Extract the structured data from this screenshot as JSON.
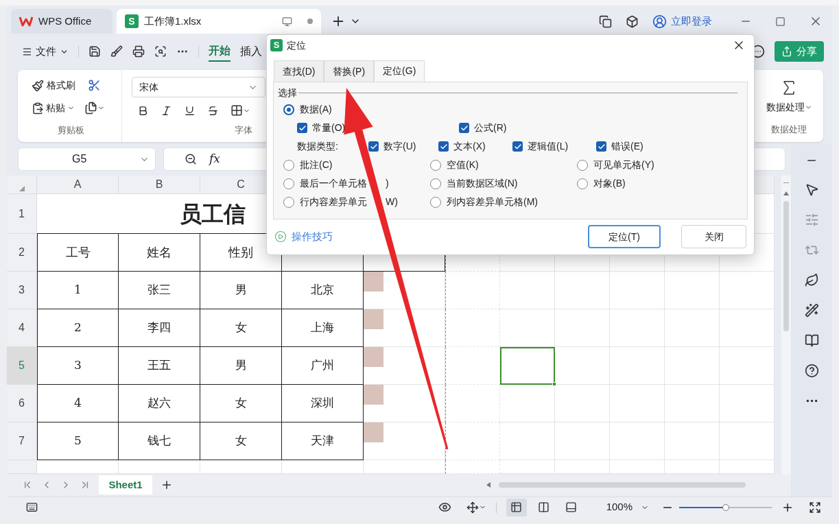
{
  "window_tabs": [
    {
      "label": "WPS Office",
      "kind": "home",
      "selected": false
    },
    {
      "label": "工作簿1.xlsx",
      "kind": "sheet",
      "icon_letter": "S",
      "selected": true
    }
  ],
  "login": "立即登录",
  "menu": {
    "file": "文件",
    "tabs": [
      {
        "label": "开始",
        "selected": true
      },
      {
        "label": "插入",
        "selected": false
      }
    ],
    "share": "分享"
  },
  "ribbon": {
    "format_painter": "格式刷",
    "paste": "粘贴",
    "clipboard_title": "剪贴板",
    "font_name": "宋体",
    "font_title": "字体",
    "data_button": "数据处理",
    "data_title": "数据处理"
  },
  "formula_bar": {
    "name_box": "G5",
    "function": "fx"
  },
  "sheet": {
    "columns": [
      "A",
      "B",
      "C"
    ],
    "rows": [
      {
        "label": "1",
        "selected": false
      },
      {
        "label": "2",
        "selected": false
      },
      {
        "label": "3",
        "selected": false
      },
      {
        "label": "4",
        "selected": false
      },
      {
        "label": "5",
        "selected": true
      },
      {
        "label": "6",
        "selected": false
      },
      {
        "label": "7",
        "selected": false
      }
    ],
    "title": "员工信",
    "header": [
      "工号",
      "姓名",
      "性别"
    ],
    "records": [
      [
        "1",
        "张三",
        "男",
        "北京"
      ],
      [
        "2",
        "李四",
        "女",
        "上海"
      ],
      [
        "3",
        "王五",
        "男",
        "广州"
      ],
      [
        "4",
        "赵六",
        "女",
        "深圳"
      ],
      [
        "5",
        "钱七",
        "女",
        "天津"
      ]
    ]
  },
  "sheet_tabs": [
    {
      "label": "Sheet1",
      "selected": true
    }
  ],
  "status_bar": {
    "views": [
      {
        "kind": "normal",
        "selected": true
      },
      {
        "kind": "columns",
        "selected": false
      },
      {
        "kind": "reading",
        "selected": false
      }
    ],
    "zoom": "100%",
    "zoom_slider": {
      "level": 0.5
    }
  },
  "dialog": {
    "icon_letter": "S",
    "title": "定位",
    "tabs": [
      {
        "label": "查找(D)",
        "selected": false
      },
      {
        "label": "替换(P)",
        "selected": false
      },
      {
        "label": "定位(G)",
        "selected": true
      }
    ],
    "group": "选择",
    "data_option": {
      "label": "数据(A)",
      "selected": true
    },
    "data_checks": [
      {
        "label": "常量(O)",
        "checked": true
      },
      {
        "label": "公式(R)",
        "checked": true
      }
    ],
    "type_label": "数据类型:",
    "type_checks": [
      {
        "label": "数字(U)",
        "checked": true
      },
      {
        "label": "文本(X)",
        "checked": true
      },
      {
        "label": "逻辑值(L)",
        "checked": true
      },
      {
        "label": "错误(E)",
        "checked": true
      }
    ],
    "options": [
      {
        "label": "批注(C)",
        "selected": false
      },
      {
        "label": "空值(K)",
        "selected": false
      },
      {
        "label": "可见单元格(Y)",
        "selected": false
      },
      {
        "label": "最后一个单元格",
        "label_end": ")",
        "selected": false
      },
      {
        "label": "当前数据区域(N)",
        "selected": false
      },
      {
        "label": "对象(B)",
        "selected": false
      },
      {
        "label": "行内容差异单元",
        "label_end": "W)",
        "selected": false
      },
      {
        "label": "列内容差异单元格(M)",
        "selected": false
      }
    ],
    "tips": "操作技巧",
    "buttons": [
      {
        "label": "定位(T)",
        "primary": true
      },
      {
        "label": "关闭",
        "primary": false
      }
    ]
  }
}
